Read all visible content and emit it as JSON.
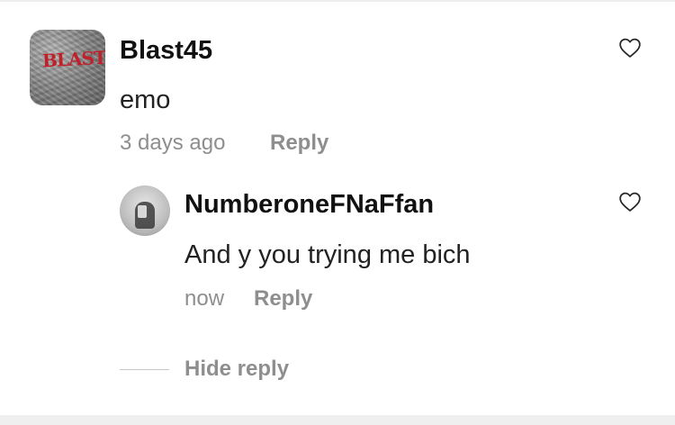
{
  "comment": {
    "avatar_logo_text": "BLAST",
    "username": "Blast45",
    "text": "emo",
    "timestamp": "3 days ago",
    "reply_label": "Reply",
    "like_icon": "heart-outline-icon"
  },
  "reply": {
    "username": "NumberoneFNaFfan",
    "text": "And y you trying me bich",
    "timestamp": "now",
    "reply_label": "Reply",
    "like_icon": "heart-outline-icon"
  },
  "thread": {
    "hide_replies_label": "Hide reply"
  },
  "colors": {
    "primary_text": "#111111",
    "secondary_text": "#8e8e8e",
    "logo_red": "#c0202a"
  }
}
